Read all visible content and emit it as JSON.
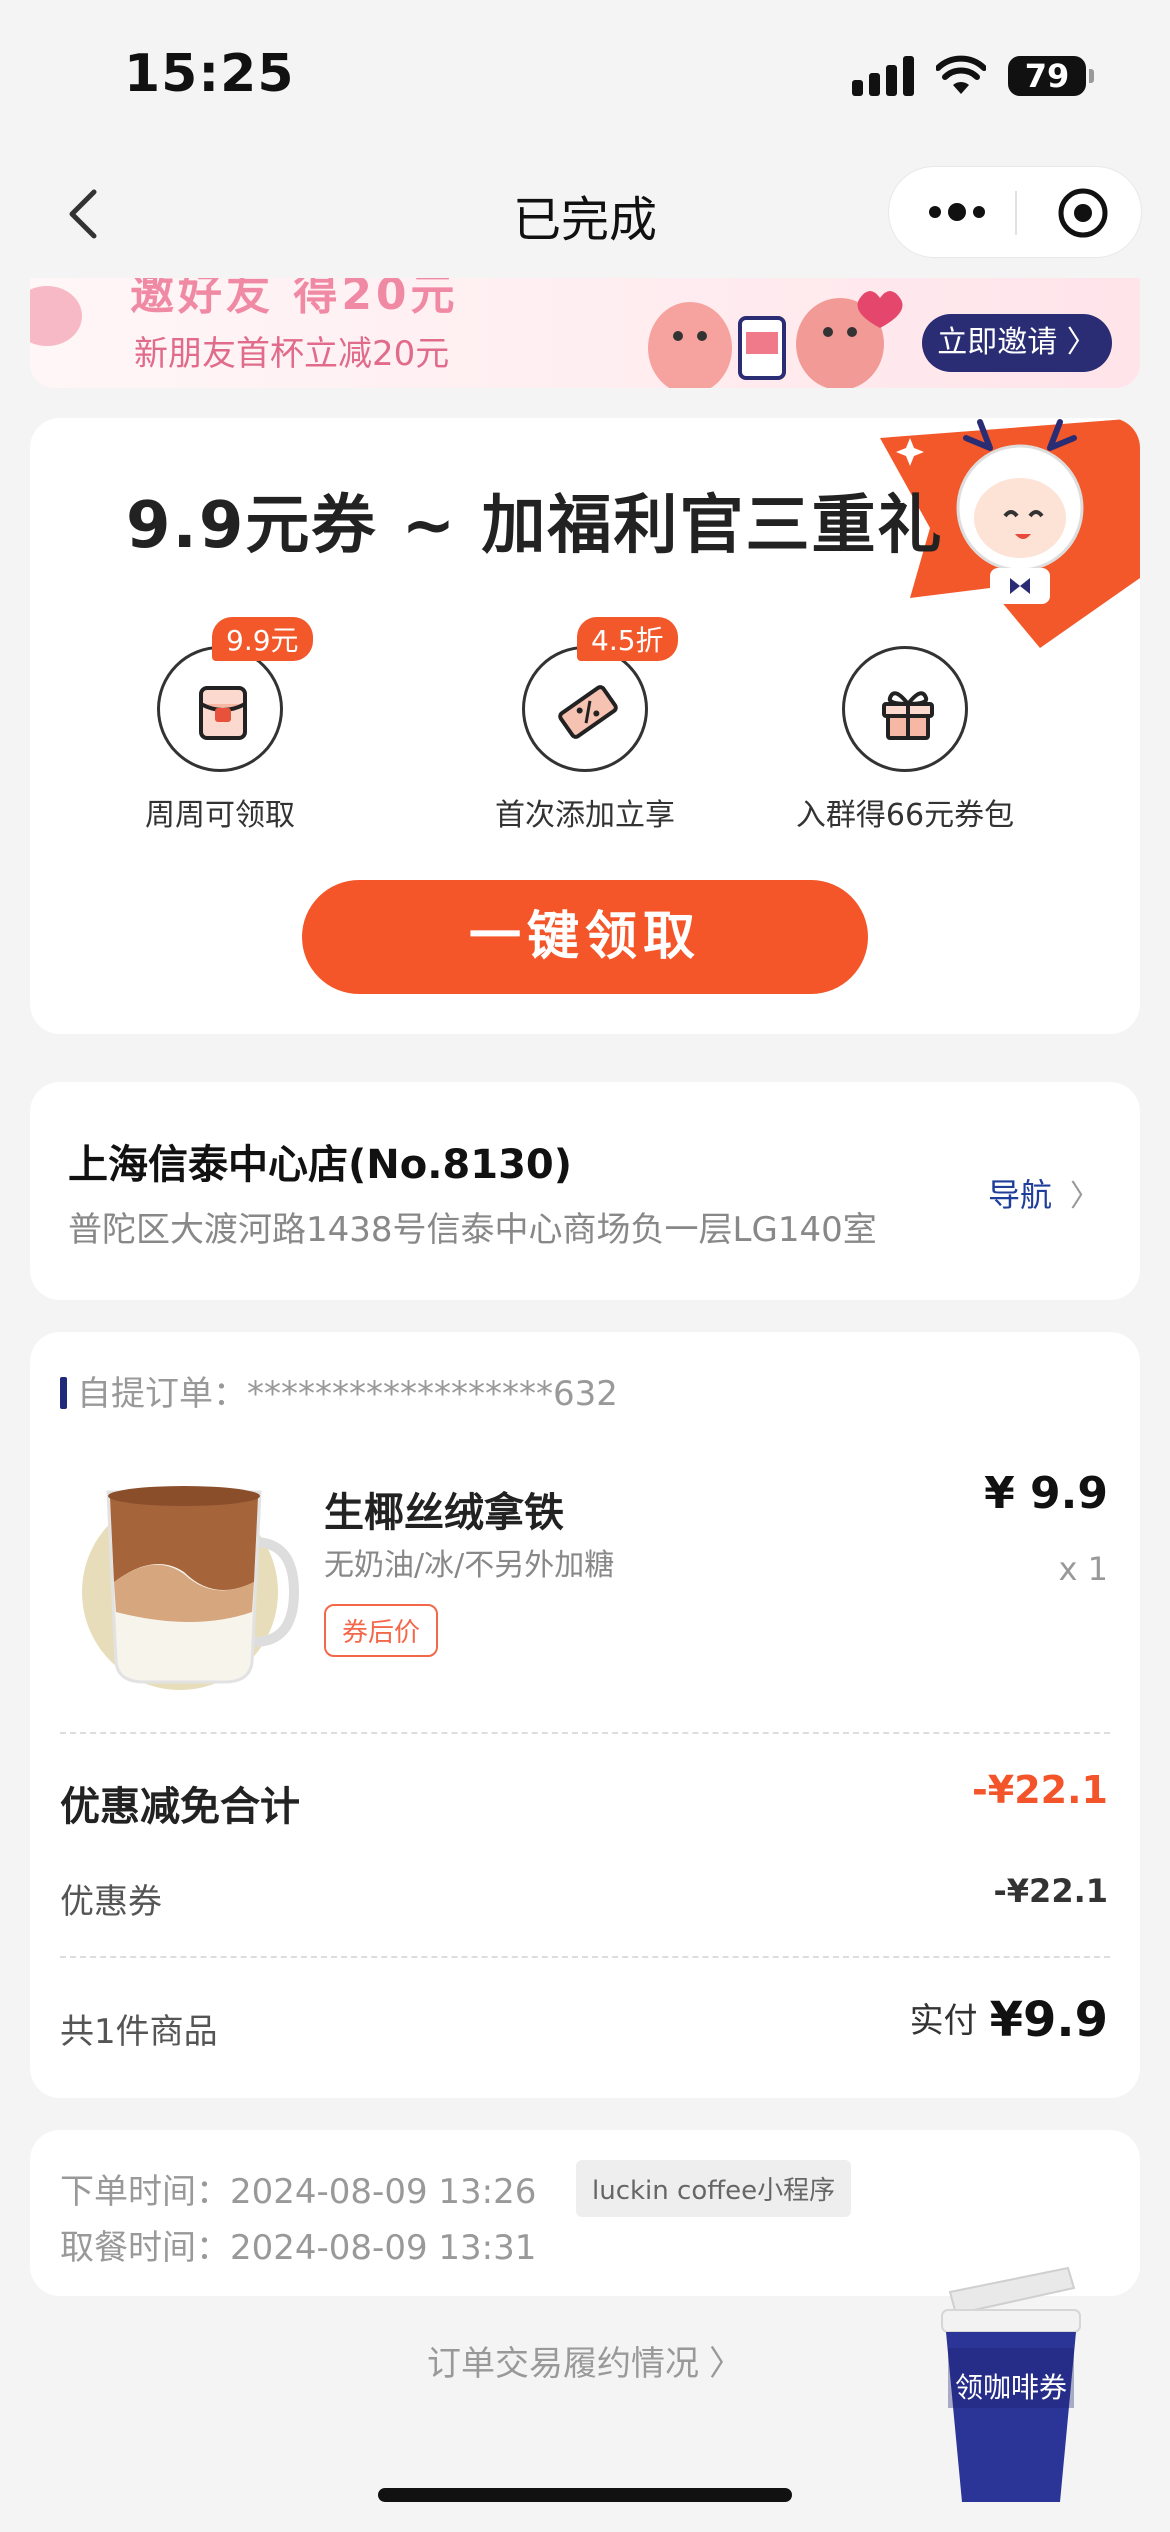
{
  "status_bar": {
    "time": "15:25",
    "battery": "79"
  },
  "nav": {
    "title": "已完成"
  },
  "banner": {
    "title": "邀好友 得20元",
    "subtitle": "新朋友首杯立减20元",
    "invite_label": "立即邀请 〉"
  },
  "coupon": {
    "title": "9.9元券 ~ 加福利官三重礼",
    "perks": [
      {
        "tag": "9.9元",
        "label": "周周可领取",
        "icon": "red-envelope-icon"
      },
      {
        "tag": "4.5折",
        "label": "首次添加立享",
        "icon": "discount-ticket-icon"
      },
      {
        "tag": "",
        "label": "入群得66元券包",
        "icon": "gift-icon"
      }
    ],
    "claim_label": "一键领取"
  },
  "store": {
    "name": "上海信泰中心店(No.8130)",
    "address": "普陀区大渡河路1438号信泰中心商场负一层LG140室",
    "nav_label": "导航"
  },
  "order": {
    "header_label": "自提订单：",
    "order_no": "******************632",
    "product": {
      "name": "生椰丝绒拿铁",
      "spec": "无奶油/冰/不另外加糖",
      "tag": "券后价",
      "price": "¥ 9.9",
      "qty": "x 1"
    },
    "discount_title": "优惠减免合计",
    "discount_total": "-¥22.1",
    "coupon_label": "优惠券",
    "coupon_amount": "-¥22.1",
    "total_label": "共1件商品",
    "paid_label": "实付",
    "paid_amount": "¥9.9"
  },
  "times": {
    "order_time": "下单时间：2024-08-09 13:26",
    "source": "luckin coffee小程序",
    "pickup_time": "取餐时间：2024-08-09 13:31"
  },
  "footer_link": "订单交易履约情况",
  "float_cup_label": "领咖啡券",
  "colors": {
    "accent": "#f45629",
    "brand_blue": "#1f2a7a",
    "discount_red": "#f4542a"
  }
}
